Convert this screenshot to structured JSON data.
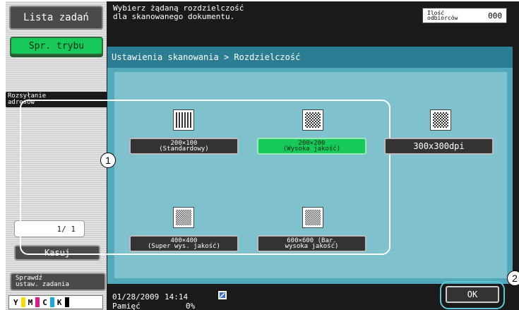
{
  "left_panel": {
    "job_list_label": "Lista zadań",
    "mode_check_label": "Spr. trybu",
    "address_tab_label": "Rozsyłanie\nadresów",
    "page_counter": "1/ 1",
    "delete_label": "Kasuj",
    "check_job_label": "Sprawdź\nustaw. zadania",
    "toner": [
      "Y",
      "M",
      "C",
      "K"
    ],
    "toner_colors": [
      "#f5d90a",
      "#d81e8c",
      "#1aa6e0",
      "#000000"
    ]
  },
  "header": {
    "message": "Wybierz żądaną rozdzielczość\ndla skanowanego dokumentu.",
    "recipients_label": "Ilość\nodbiorców",
    "recipients_count": "000"
  },
  "panel": {
    "title": "Ustawienia skanowania > Rozdzielczość",
    "options": [
      {
        "label": "200×100\n(Standardowy)",
        "selected": false,
        "icon": "resolution-200x100-icon"
      },
      {
        "label": "200×200\n(Wysoka jakość)",
        "selected": true,
        "icon": "resolution-200x200-icon"
      },
      {
        "label": "300x300dpi",
        "selected": false,
        "icon": "resolution-300x300-icon"
      },
      {
        "label": "400×400\n(Super wys. jakość)",
        "selected": false,
        "icon": "resolution-400x400-icon"
      },
      {
        "label": "600×600 (Bar.\nwysoka jakość)",
        "selected": false,
        "icon": "resolution-600x600-icon"
      }
    ]
  },
  "callouts": [
    "1",
    "2"
  ],
  "status": {
    "date": "01/28/2009",
    "time": "14:14",
    "memory_label": "Pamięć",
    "memory_value": "0%"
  },
  "ok_label": "OK",
  "colors": {
    "accent_green": "#16c95a",
    "panel_teal": "#52a9ba",
    "title_teal": "#2a7d92"
  }
}
